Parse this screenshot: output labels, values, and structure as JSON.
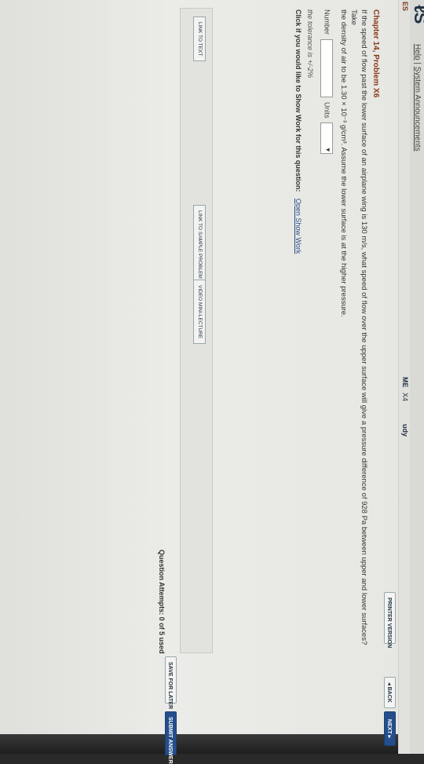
{
  "header": {
    "logo": "ℓS",
    "help_link": "Help",
    "separator": "|",
    "announcements_link": "System Announcements"
  },
  "left_tabs": {
    "tab1": "ES",
    "tab2": "ME",
    "tab3": "X4",
    "tab4": "udy"
  },
  "toolbar": {
    "printer_version": "PRINTER VERSION",
    "back": "◂ BACK",
    "next": "NEXT ▸"
  },
  "problem": {
    "title": "Chapter 14, Problem X6",
    "text_line1": "If the speed of flow past the lower surface of an airplane wing is 130 m/s, what speed of flow over the upper surface will give a pressure difference of 928 Pa between upper and lower surfaces? Take",
    "text_line2": "the density of air to be 1.30 × 10⁻³ g/cm³. Assume the lower surface is at the higher pressure."
  },
  "answer": {
    "number_label": "Number",
    "number_value": "",
    "units_label": "Units",
    "units_value": "",
    "tolerance": "the tolerance is +/-2%"
  },
  "show_work": {
    "prompt": "Click if you would like to Show Work for this question:",
    "link": "Open Show Work"
  },
  "resources": {
    "link_to_text": "LINK TO TEXT",
    "sample_problem": "LINK TO SAMPLE PROBLEM",
    "video_lecture": "VIDEO MINI-LECTURE"
  },
  "footer": {
    "attempts": "Question Attempts: 0 of 5 used",
    "save_later": "SAVE FOR LATER",
    "submit": "SUBMIT ANSWER"
  }
}
